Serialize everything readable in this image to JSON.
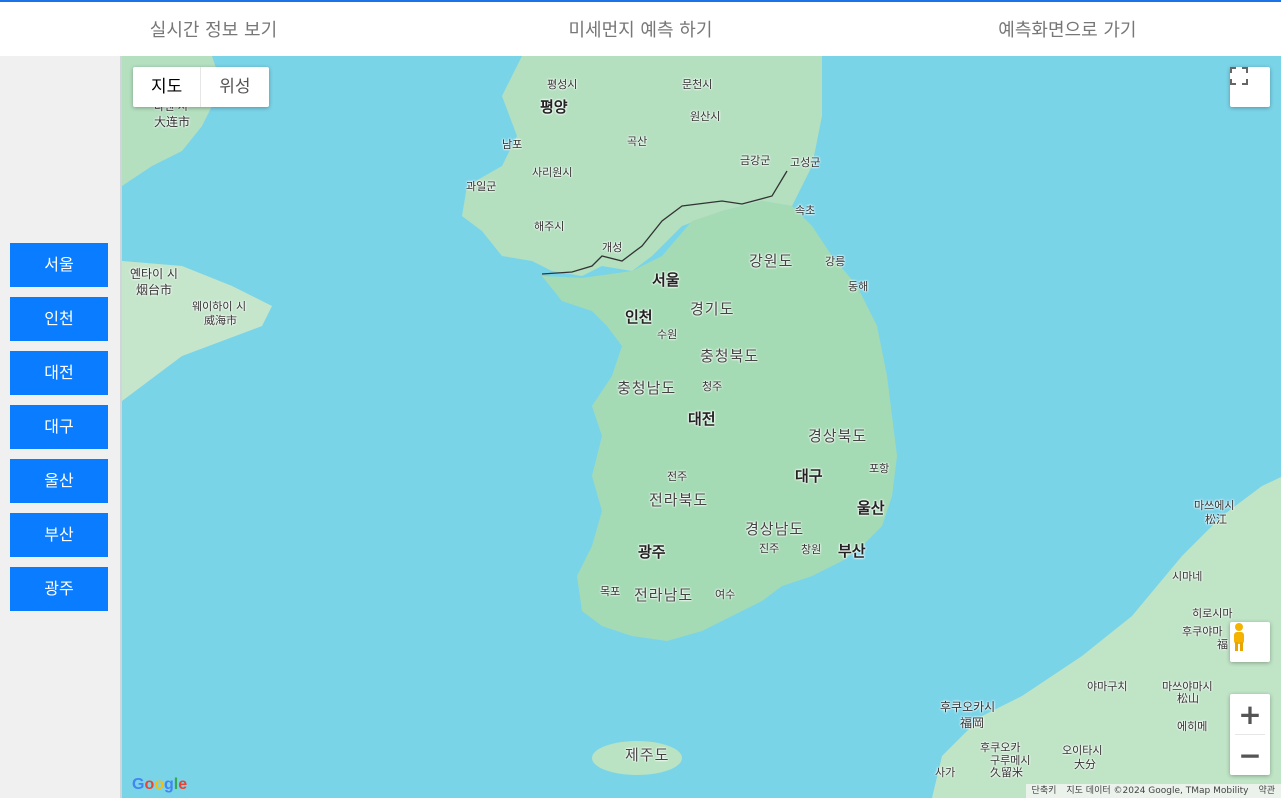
{
  "nav": {
    "tabs": [
      "실시간 정보 보기",
      "미세먼지 예측 하기",
      "예측화면으로 가기"
    ]
  },
  "sidebar": {
    "cities": [
      "서울",
      "인천",
      "대전",
      "대구",
      "울산",
      "부산",
      "광주"
    ]
  },
  "map": {
    "type_buttons": {
      "map": "지도",
      "satellite": "위성"
    },
    "zoom_in": "+",
    "zoom_out": "−",
    "logo": "Google",
    "attribution": {
      "shortcuts": "단축키",
      "data": "지도 데이터 ©2024 Google, TMap Mobility",
      "terms": "약관"
    },
    "colors": {
      "sea": "#7ad4e8",
      "land": "#a8dcb8",
      "button": "#0a7cff"
    },
    "labels": {
      "pyongyang": "평양",
      "pyeongseong": "평성시",
      "muncheon": "문천시",
      "wonsan": "원산시",
      "nampo": "남포",
      "goksan": "곡산",
      "sariwon": "사리원시",
      "geumgang": "금강군",
      "goseong": "고성군",
      "gwail": "과일군",
      "haeju": "해주시",
      "sokcho": "속초",
      "kaesong": "개성",
      "gangwon": "강원도",
      "gangneung": "강릉",
      "seoul": "서울",
      "donghae": "동해",
      "incheon": "인천",
      "gyeonggi": "경기도",
      "suwon": "수원",
      "chungbuk": "충청북도",
      "chungnam": "충청남도",
      "cheongju": "청주",
      "daejeon": "대전",
      "gyeongbuk": "경상북도",
      "pohang": "포항",
      "daegu": "대구",
      "jeonju": "전주",
      "jeonbuk": "전라북도",
      "ulsan": "울산",
      "gyeongnam": "경상남도",
      "gwangju": "광주",
      "jinju": "진주",
      "changwon": "창원",
      "busan": "부산",
      "mokpo": "목포",
      "jeonnam": "전라남도",
      "yeosu": "여수",
      "jeju": "제주도",
      "dalian_ko": "다롄 시",
      "dalian_cn": "大连市",
      "yantai_ko": "옌타이 시",
      "yantai_cn": "烟台市",
      "weihai_ko": "웨이하이 시",
      "weihai_cn": "威海市",
      "matsue_ko": "마쓰에시",
      "matsue_jp": "松江",
      "shimane": "시마네",
      "hiroshima": "히로시마",
      "fukuyama_ko": "후쿠야마",
      "fukuyama_jp": "福",
      "yamaguchi": "야마구치",
      "matsuyama_ko": "마쓰야마시",
      "matsuyama_jp": "松山",
      "ehime": "에히메",
      "fukuoka_ko": "후쿠오카시",
      "fukuoka_jp": "福岡",
      "kurume_ko": "구루메시",
      "kurume_jp": "久留米",
      "kurume_top": "후쿠오카",
      "oita_ko": "오이타시",
      "oita_jp": "大分",
      "saga": "사가"
    }
  }
}
